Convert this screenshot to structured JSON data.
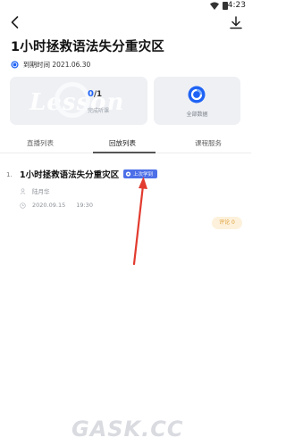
{
  "status_bar": {
    "time": "4:23"
  },
  "header": {
    "back_icon": "chevron-left-icon",
    "download_icon": "download-icon"
  },
  "course": {
    "title": "1小时拯救语法失分重灾区",
    "expire_text": "到期时间 2021.06.30"
  },
  "progress_card": {
    "watermark": "Lesson",
    "completed": "0",
    "total": "/1",
    "label": "完成听课"
  },
  "data_card": {
    "label": "全部数据",
    "icon": "data-ring-icon"
  },
  "tabs": [
    {
      "label": "直播列表",
      "active": false
    },
    {
      "label": "回放列表",
      "active": true
    },
    {
      "label": "课程服务",
      "active": false
    }
  ],
  "lesson": {
    "index": "1.",
    "title": "1小时拯救语法失分重灾区",
    "badge": "上次学到",
    "teacher": "陆月华",
    "date": "2020.09.15",
    "time": "19:30",
    "comment_label": "评论 0"
  },
  "colors": {
    "accent": "#1f63f5",
    "badge": "#4d6fe8",
    "arrow": "#e23b2f",
    "comment_bg": "#fdf1dc",
    "comment_text": "#e0a23a"
  },
  "footer_watermark": "GASK.CC"
}
